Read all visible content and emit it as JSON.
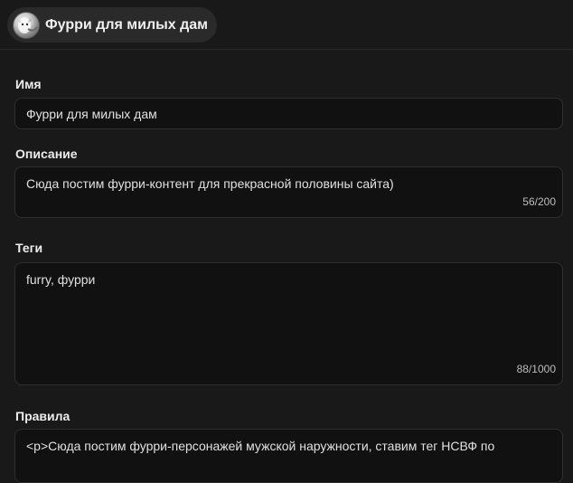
{
  "header": {
    "community_title": "Фурри для милых дам",
    "avatar_icon": "community-avatar-icon"
  },
  "form": {
    "name": {
      "label": "Имя",
      "value": "Фурри для милых дам"
    },
    "description": {
      "label": "Описание",
      "value": "Сюда постим фурри-контент для прекрасной половины сайта)",
      "counter": "56/200"
    },
    "tags": {
      "label": "Теги",
      "value": "furry, фурри",
      "counter": "88/1000"
    },
    "rules": {
      "label": "Правила",
      "value": "<p>Сюда постим фурри-персонажей мужской наружности, ставим тег НСВФ по"
    }
  }
}
